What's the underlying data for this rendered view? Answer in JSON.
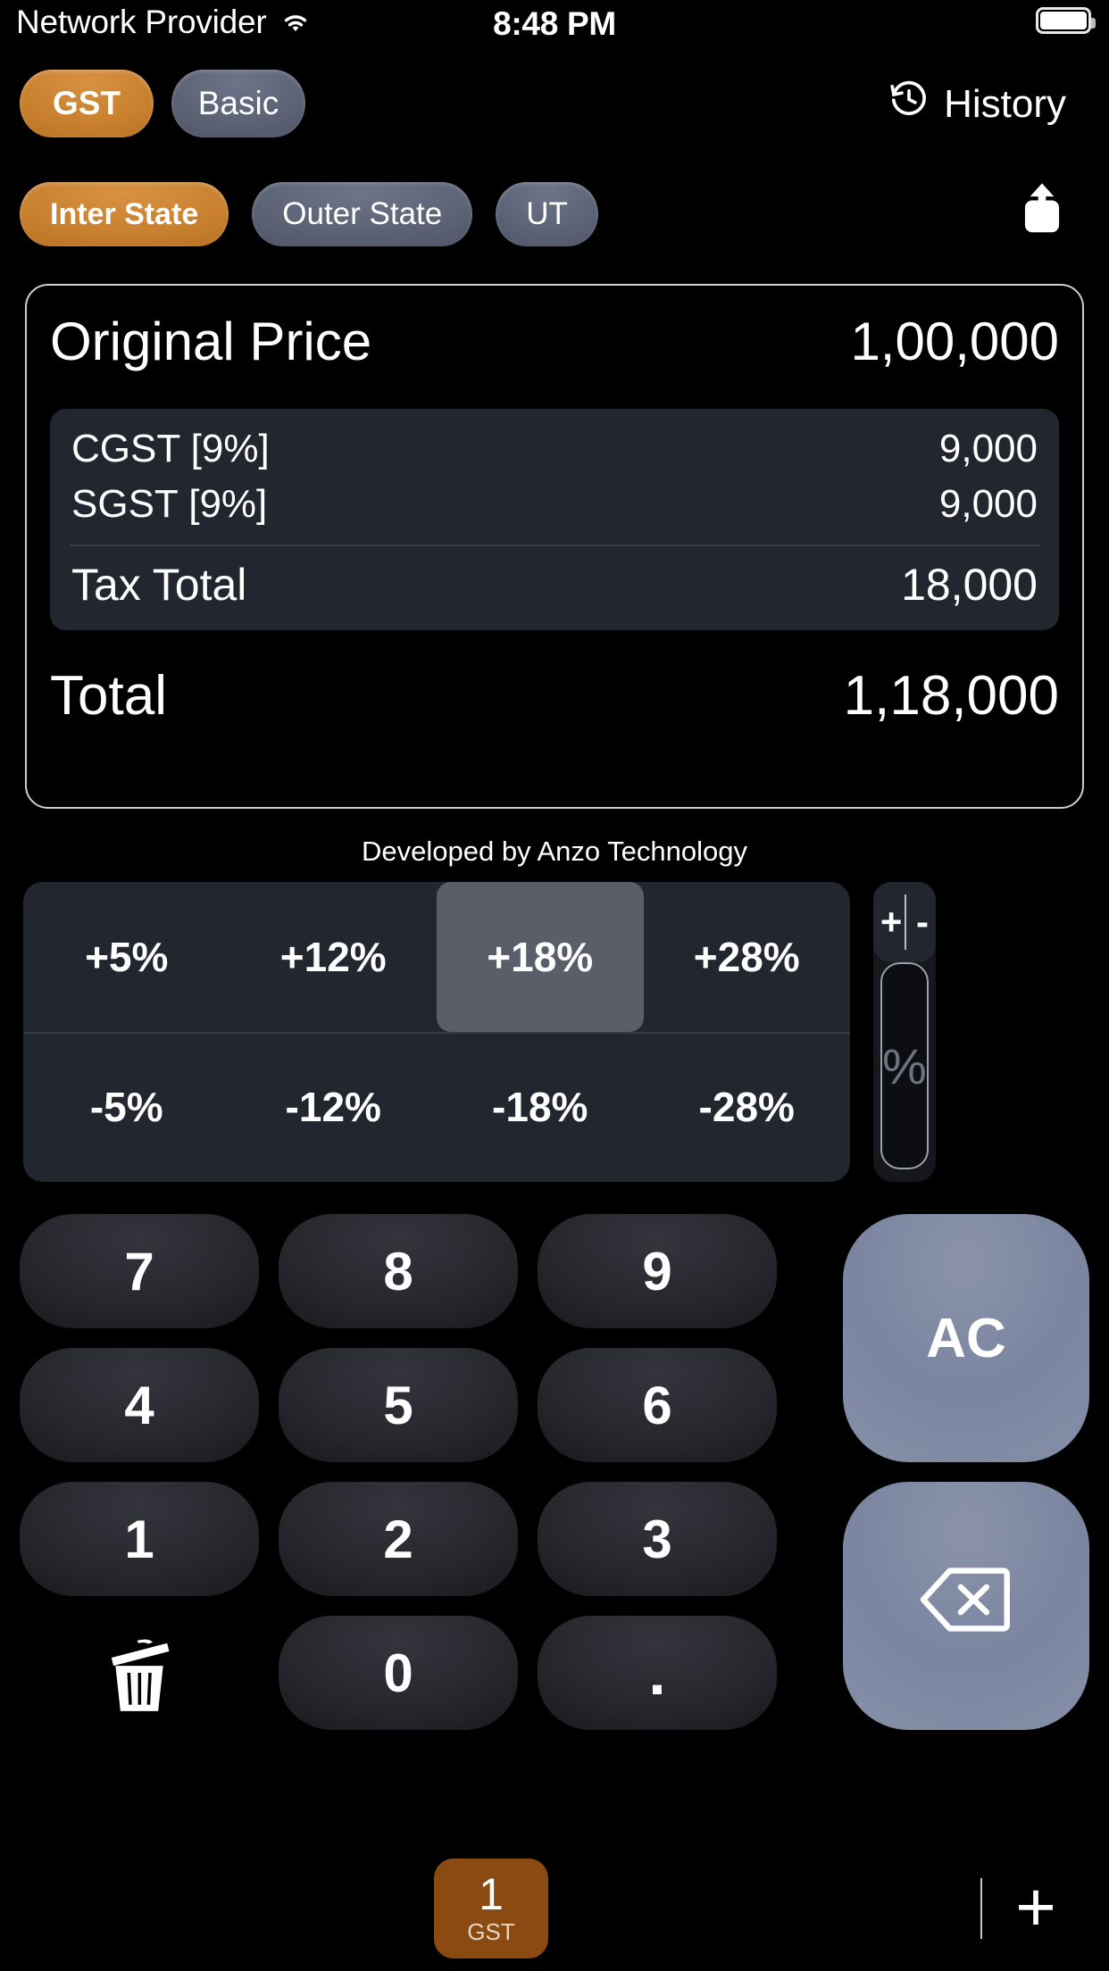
{
  "status_bar": {
    "carrier": "Network Provider",
    "wifi_icon": "wifi-icon",
    "time": "8:48 PM",
    "battery_icon": "battery-full-icon"
  },
  "header": {
    "modes": [
      {
        "label": "GST",
        "selected": true
      },
      {
        "label": "Basic",
        "selected": false
      }
    ],
    "history_label": "History",
    "history_icon": "clock-history-icon"
  },
  "state_selector": {
    "options": [
      {
        "label": "Inter State",
        "selected": true
      },
      {
        "label": "Outer State",
        "selected": false
      },
      {
        "label": "UT",
        "selected": false
      }
    ],
    "share_icon": "share-icon"
  },
  "result_card": {
    "original_price_label": "Original Price",
    "original_price_value": "1,00,000",
    "tax_rows": [
      {
        "label": "CGST [9%]",
        "value": "9,000"
      },
      {
        "label": "SGST [9%]",
        "value": "9,000"
      }
    ],
    "tax_total_label": "Tax Total",
    "tax_total_value": "18,000",
    "total_label": "Total",
    "total_value": "1,18,000"
  },
  "credit": "Developed by Anzo Technology",
  "percent_panel": {
    "cells": [
      {
        "label": "+5%",
        "selected": false
      },
      {
        "label": "+12%",
        "selected": false
      },
      {
        "label": "+18%",
        "selected": true
      },
      {
        "label": "+28%",
        "selected": false
      },
      {
        "label": "-5%",
        "selected": false
      },
      {
        "label": "-12%",
        "selected": false
      },
      {
        "label": "-18%",
        "selected": false
      },
      {
        "label": "-28%",
        "selected": false
      }
    ],
    "plus_label": "+",
    "minus_label": "-",
    "percent_label": "%"
  },
  "keypad": {
    "row1": [
      "7",
      "8",
      "9"
    ],
    "row2": [
      "4",
      "5",
      "6"
    ],
    "row3": [
      "1",
      "2",
      "3"
    ],
    "row4": [
      "0",
      "."
    ],
    "trash_icon": "trash-icon",
    "ac_label": "AC",
    "backspace_icon": "backspace-icon"
  },
  "bottom_bar": {
    "tab_number": "1",
    "tab_label": "GST",
    "add_label": "+",
    "add_icon": "plus-icon"
  },
  "colors": {
    "accent_orange": "#c9812f",
    "slate": "#5c6375",
    "panel": "#22262f",
    "selected_cell": "#5a5e69",
    "big_key": "#8a93aa",
    "tab_brown": "#8a4a12"
  }
}
